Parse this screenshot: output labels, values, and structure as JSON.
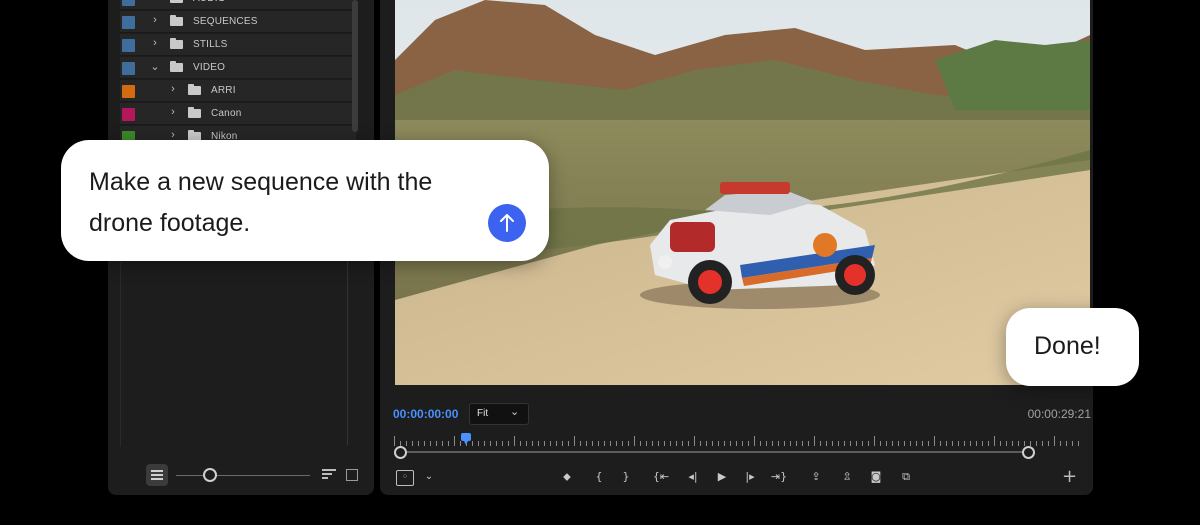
{
  "project_panel": {
    "tree": [
      {
        "label": "AUDIO",
        "color": "#3f6e9c",
        "expanded": false,
        "indent": 0
      },
      {
        "label": "SEQUENCES",
        "color": "#3f6e9c",
        "expanded": false,
        "indent": 0
      },
      {
        "label": "STILLS",
        "color": "#3f6e9c",
        "expanded": false,
        "indent": 0
      },
      {
        "label": "VIDEO",
        "color": "#3f6e9c",
        "expanded": true,
        "indent": 0
      },
      {
        "label": "ARRI",
        "color": "#d36b12",
        "expanded": false,
        "indent": 1
      },
      {
        "label": "Canon",
        "color": "#b4185a",
        "expanded": false,
        "indent": 1
      },
      {
        "label": "Nikon",
        "color": "#3a8a2a",
        "expanded": false,
        "indent": 1
      }
    ],
    "footer_icons": [
      "list-view-icon",
      "zoom-slider",
      "sort-icon",
      "bin-icon"
    ]
  },
  "program_monitor": {
    "timecode_current": "00:00:00:00",
    "zoom_fit": "Fit",
    "timecode_duration": "00:00:29:21",
    "playhead_fraction": 0.1,
    "controls": [
      {
        "name": "add-marker-icon",
        "glyph": "⬥"
      },
      {
        "name": "mark-in-icon",
        "glyph": "{"
      },
      {
        "name": "mark-out-icon",
        "glyph": "}"
      },
      {
        "name": "go-to-in-icon",
        "glyph": "{⇤"
      },
      {
        "name": "step-back-icon",
        "glyph": "◂|"
      },
      {
        "name": "play-icon",
        "glyph": "▶"
      },
      {
        "name": "step-forward-icon",
        "glyph": "|▸"
      },
      {
        "name": "go-to-out-icon",
        "glyph": "⇥}"
      },
      {
        "name": "lift-icon",
        "glyph": "⇪"
      },
      {
        "name": "extract-icon",
        "glyph": "⇫"
      },
      {
        "name": "export-frame-icon",
        "glyph": "◙"
      },
      {
        "name": "comparison-view-icon",
        "glyph": "⧉"
      }
    ],
    "plus_label": "+"
  },
  "chat": {
    "prompt": "Make a new sequence with the drone footage.",
    "response": "Done!",
    "send_color": "#3b63f0"
  },
  "colors": {
    "accent": "#4a90ff",
    "panel_bg": "#1d1d1d",
    "page_bg": "#000000"
  }
}
